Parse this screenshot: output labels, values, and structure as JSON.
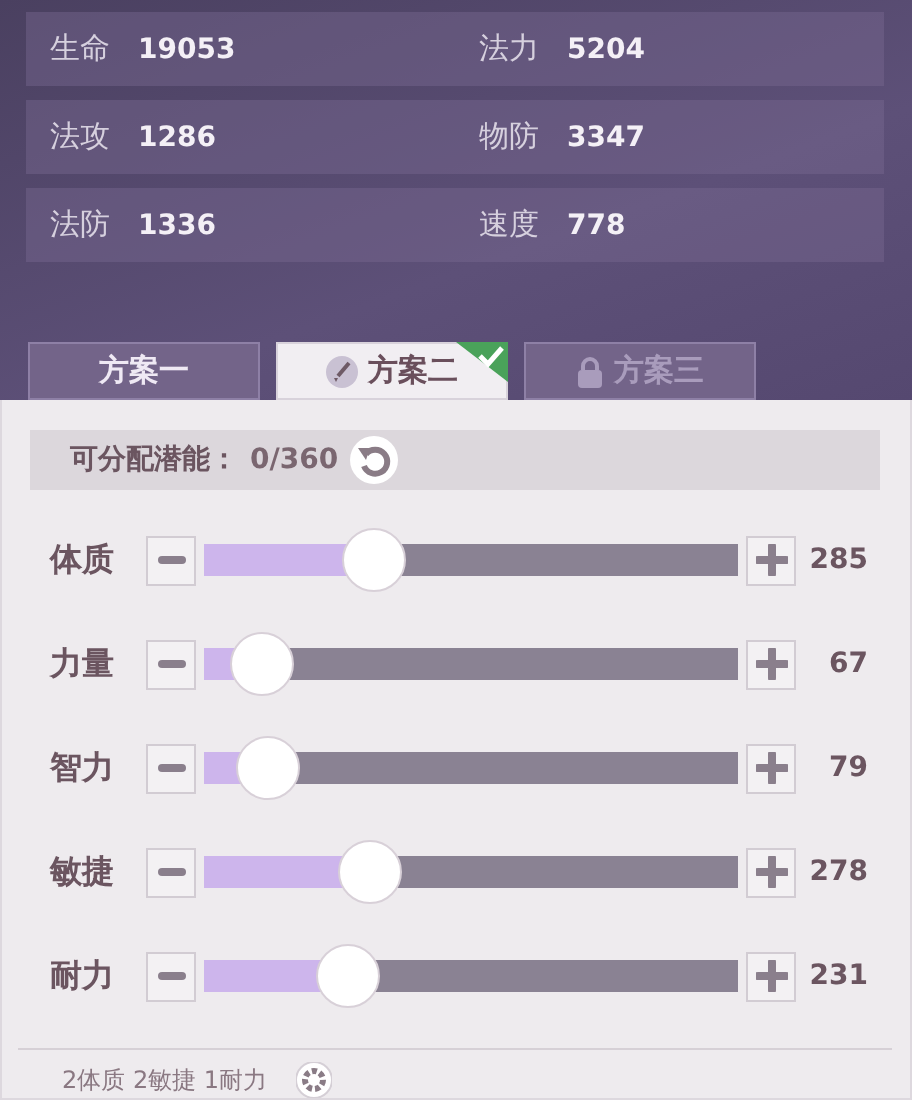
{
  "stats": [
    {
      "label": "生命",
      "value": "19053"
    },
    {
      "label": "法力",
      "value": "5204"
    },
    {
      "label": "法攻",
      "value": "1286"
    },
    {
      "label": "物防",
      "value": "3347"
    },
    {
      "label": "法防",
      "value": "1336"
    },
    {
      "label": "速度",
      "value": "778"
    }
  ],
  "tabs": [
    {
      "label": "方案一",
      "selected": false,
      "locked": false
    },
    {
      "label": "方案二",
      "selected": true,
      "locked": false
    },
    {
      "label": "方案三",
      "selected": false,
      "locked": true
    }
  ],
  "potential": {
    "label": "可分配潜能：",
    "value": "0/360"
  },
  "attributes": [
    {
      "name": "体质",
      "level": 0.32,
      "value": "285"
    },
    {
      "name": "力量",
      "level": 0.11,
      "value": "67"
    },
    {
      "name": "智力",
      "level": 0.12,
      "value": "79"
    },
    {
      "name": "敏捷",
      "level": 0.31,
      "value": "278"
    },
    {
      "name": "耐力",
      "level": 0.27,
      "value": "231"
    }
  ],
  "footer": {
    "text": "2体质 2敏捷 1耐力"
  }
}
